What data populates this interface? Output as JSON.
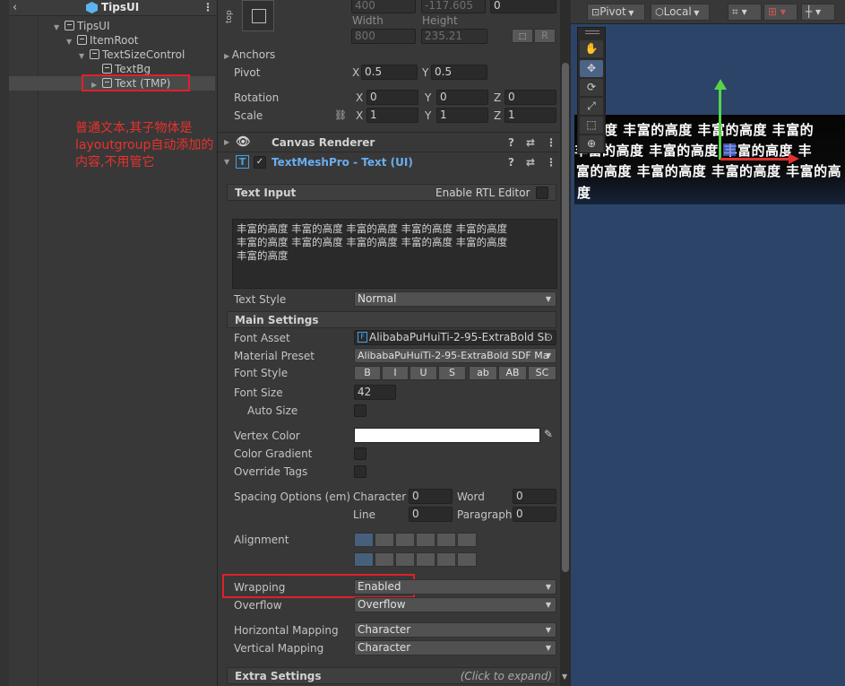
{
  "hierarchy": {
    "title": "TipsUI",
    "items": [
      {
        "label": "TipsUI"
      },
      {
        "label": "ItemRoot"
      },
      {
        "label": "TextSizeControl"
      },
      {
        "label": "TextBg"
      },
      {
        "label": "Text (TMP)"
      }
    ],
    "annotation": "普通文本,其子物体是layoutgroup自动添加的内容,不用管它"
  },
  "inspector": {
    "rect": {
      "top_label": "top",
      "row1": [
        "400",
        "-117.605",
        "0"
      ],
      "width_label": "Width",
      "height_label": "Height",
      "width": "800",
      "height": "235.21",
      "r_button": "R"
    },
    "anchors_label": "Anchors",
    "pivot_label": "Pivot",
    "pivot": {
      "x": "0.5",
      "y": "0.5"
    },
    "rotation_label": "Rotation",
    "rotation": {
      "x": "0",
      "y": "0",
      "z": "0"
    },
    "scale_label": "Scale",
    "scale": {
      "x": "1",
      "y": "1",
      "z": "1"
    },
    "axis": {
      "x": "X",
      "y": "Y",
      "z": "Z"
    },
    "canvas_renderer": "Canvas Renderer",
    "tmp_component": "TextMeshPro - Text (UI)",
    "text_input_label": "Text Input",
    "rtl_label": "Enable RTL Editor",
    "text_lines": [
      "丰富的高度 丰富的高度 丰富的高度 丰富的高度 丰富的高度",
      "丰富的高度 丰富的高度 丰富的高度 丰富的高度 丰富的高度",
      "丰富的高度"
    ],
    "text_style_label": "Text Style",
    "text_style": "Normal",
    "main_settings": "Main Settings",
    "font_asset_label": "Font Asset",
    "font_asset": "AlibabaPuHuiTi-2-95-ExtraBold SI",
    "material_preset_label": "Material Preset",
    "material_preset": "AlibabaPuHuiTi-2-95-ExtraBold SDF Ma",
    "font_style_label": "Font Style",
    "font_styles": [
      "B",
      "I",
      "U",
      "S",
      "ab",
      "AB",
      "SC"
    ],
    "font_size_label": "Font Size",
    "font_size": "42",
    "auto_size_label": "Auto Size",
    "vertex_color_label": "Vertex Color",
    "vertex_color": "#ffffff",
    "color_gradient_label": "Color Gradient",
    "override_tags_label": "Override Tags",
    "spacing_label": "Spacing Options (em)",
    "spacing": {
      "character_label": "Character",
      "character": "0",
      "word_label": "Word",
      "word": "0",
      "line_label": "Line",
      "line": "0",
      "paragraph_label": "Paragraph",
      "paragraph": "0"
    },
    "alignment_label": "Alignment",
    "wrapping_label": "Wrapping",
    "wrapping": "Enabled",
    "overflow_label": "Overflow",
    "overflow": "Overflow",
    "h_mapping_label": "Horizontal Mapping",
    "h_mapping": "Character",
    "v_mapping_label": "Vertical Mapping",
    "v_mapping": "Character",
    "extra_settings": "Extra Settings",
    "click_to_expand": "(Click to expand)"
  },
  "scene": {
    "pivot_label": "Pivot",
    "local_label": "Local",
    "text_lines": [
      "的高度 丰富的高度 丰富的高度 丰富的",
      " 丰富的高度 丰富的高度 丰富的高度 丰",
      "富的高度 丰富的高度 丰富的高度 丰富的高",
      "度"
    ]
  },
  "colors": {
    "annotation_red": "#e0202a",
    "selected_blue": "#46607c",
    "scene_bg": "#2c4468"
  }
}
